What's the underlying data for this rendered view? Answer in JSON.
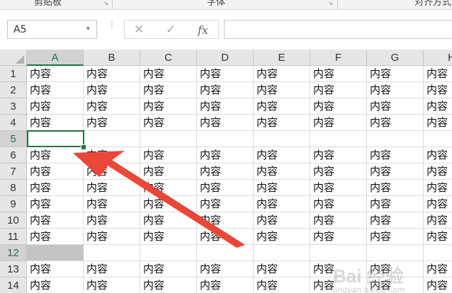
{
  "ribbon": {
    "groups": [
      {
        "label": "剪贴板",
        "launcher": "↘"
      },
      {
        "label": "字体",
        "launcher": "↘"
      },
      {
        "label": "对齐方式",
        "launcher": ""
      }
    ]
  },
  "formula_bar": {
    "name_box": "A5",
    "name_box_arrow": "▾",
    "dots": "⋮",
    "cancel_icon": "✕",
    "enter_icon": "✓",
    "fx_icon": "fx",
    "formula_value": ""
  },
  "grid": {
    "columns": [
      "A",
      "B",
      "C",
      "D",
      "E",
      "F",
      "G",
      "H"
    ],
    "selected_column": "A",
    "rows": [
      "1",
      "2",
      "3",
      "4",
      "5",
      "6",
      "7",
      "8",
      "9",
      "10",
      "11",
      "12",
      "13",
      "14"
    ],
    "selected_rows": [
      "5",
      "12"
    ],
    "cell_text": "内容",
    "empty_rows": [
      "5",
      "12"
    ],
    "active_cell": "A5",
    "highlighted_cell": "A12"
  },
  "annotation": {
    "arrow_color": "#e8473a",
    "arrow_points_to": "A5"
  },
  "watermark": {
    "text": "Bai 经验",
    "sub": "jingyan.baidu.com"
  },
  "colors": {
    "accent": "#217346",
    "header_bg": "#e6e6e6",
    "selected_header_bg": "#d2d2d2",
    "gridline": "#dcdcdc"
  }
}
